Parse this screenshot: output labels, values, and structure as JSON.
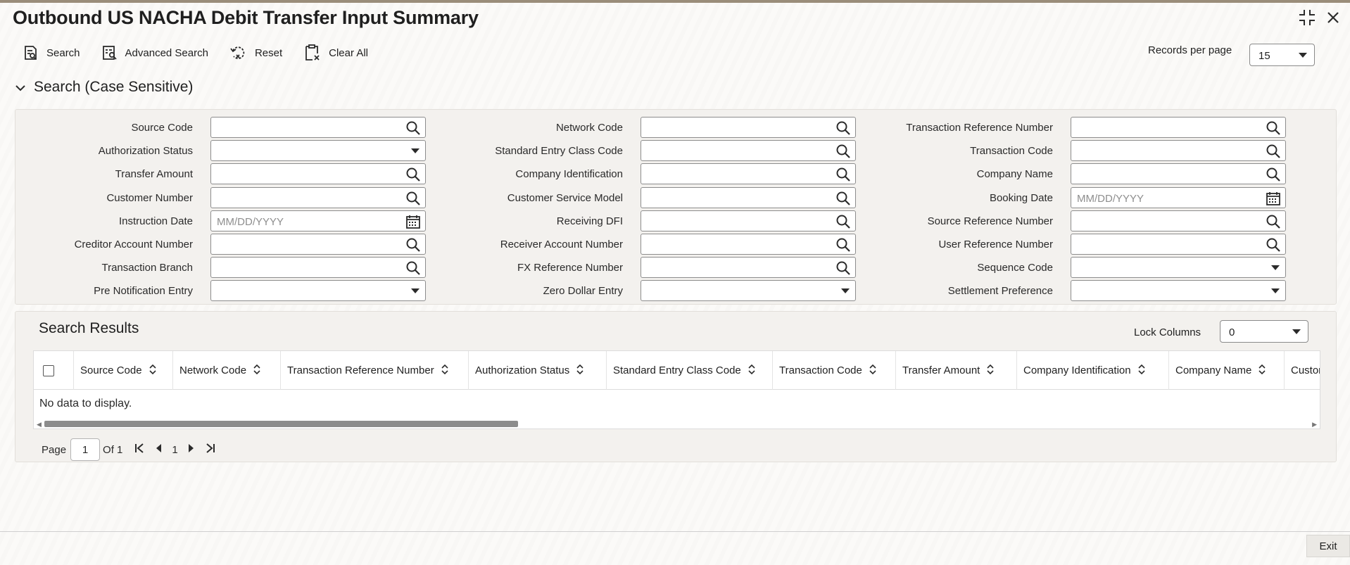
{
  "window": {
    "title": "Outbound US NACHA Debit Transfer Input Summary",
    "icons": [
      "minimize-icon",
      "close-icon"
    ]
  },
  "toolbar": {
    "search_label": "Search",
    "advanced_search_label": "Advanced Search",
    "reset_label": "Reset",
    "clear_all_label": "Clear All"
  },
  "records_per_page": {
    "label": "Records per page",
    "value": "15"
  },
  "search_section": {
    "title": "Search (Case Sensitive)",
    "col1": [
      {
        "label": "Source Code",
        "type": "lookup",
        "value": ""
      },
      {
        "label": "Authorization Status",
        "type": "select",
        "value": ""
      },
      {
        "label": "Transfer Amount",
        "type": "lookup",
        "value": ""
      },
      {
        "label": "Customer Number",
        "type": "lookup",
        "value": ""
      },
      {
        "label": "Instruction Date",
        "type": "date",
        "placeholder": "MM/DD/YYYY"
      },
      {
        "label": "Creditor Account Number",
        "type": "lookup",
        "value": ""
      },
      {
        "label": "Transaction Branch",
        "type": "lookup",
        "value": ""
      },
      {
        "label": "Pre Notification Entry",
        "type": "select",
        "value": ""
      }
    ],
    "col2": [
      {
        "label": "Network Code",
        "type": "lookup",
        "value": ""
      },
      {
        "label": "Standard Entry Class Code",
        "type": "lookup",
        "value": ""
      },
      {
        "label": "Company Identification",
        "type": "lookup",
        "value": ""
      },
      {
        "label": "Customer Service Model",
        "type": "lookup",
        "value": ""
      },
      {
        "label": "Receiving DFI",
        "type": "lookup",
        "value": ""
      },
      {
        "label": "Receiver Account Number",
        "type": "lookup",
        "value": ""
      },
      {
        "label": "FX Reference Number",
        "type": "lookup",
        "value": ""
      },
      {
        "label": "Zero Dollar Entry",
        "type": "select",
        "value": ""
      }
    ],
    "col3": [
      {
        "label": "Transaction Reference Number",
        "type": "lookup",
        "value": ""
      },
      {
        "label": "Transaction Code",
        "type": "lookup",
        "value": ""
      },
      {
        "label": "Company Name",
        "type": "lookup",
        "value": ""
      },
      {
        "label": "Booking Date",
        "type": "date",
        "placeholder": "MM/DD/YYYY"
      },
      {
        "label": "Source Reference Number",
        "type": "lookup",
        "value": ""
      },
      {
        "label": "User Reference Number",
        "type": "lookup",
        "value": ""
      },
      {
        "label": "Sequence Code",
        "type": "select",
        "value": ""
      },
      {
        "label": "Settlement Preference",
        "type": "select",
        "value": ""
      }
    ]
  },
  "results": {
    "title": "Search Results",
    "lock_columns_label": "Lock Columns",
    "lock_columns_value": "0",
    "columns": [
      "Source Code",
      "Network Code",
      "Transaction Reference Number",
      "Authorization Status",
      "Standard Entry Class Code",
      "Transaction Code",
      "Transfer Amount",
      "Company Identification",
      "Company Name",
      "Customer Number"
    ],
    "empty_message": "No data to display."
  },
  "pager": {
    "page_label": "Page",
    "current_page": "1",
    "of_label": "Of 1",
    "page_number": "1"
  },
  "footer": {
    "exit_label": "Exit"
  }
}
